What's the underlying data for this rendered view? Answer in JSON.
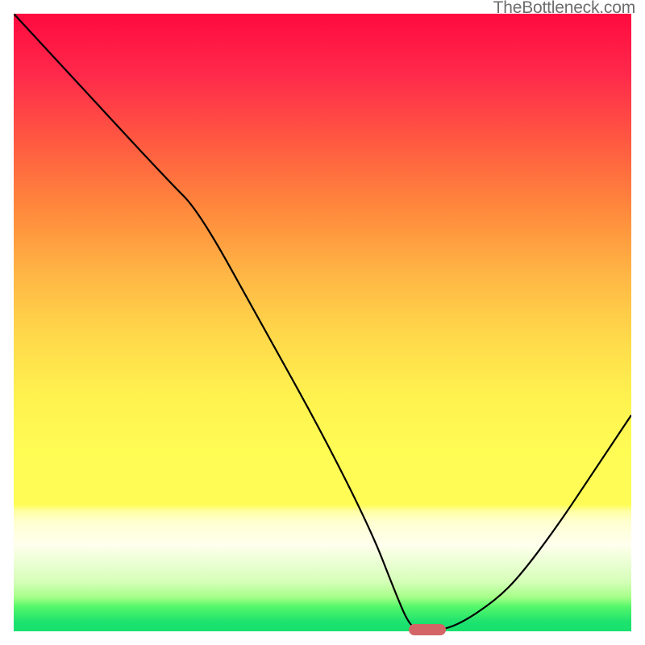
{
  "watermark": "TheBottleneck.com",
  "chart_data": {
    "type": "line",
    "title": "",
    "xlabel": "",
    "ylabel": "",
    "xlim": [
      0,
      100
    ],
    "ylim": [
      0,
      100
    ],
    "grid": false,
    "legend": false,
    "series": [
      {
        "name": "bottleneck-curve",
        "x": [
          0,
          12,
          25,
          30,
          40,
          50,
          58,
          61.5,
          64,
          66,
          68,
          72,
          78,
          82,
          88,
          94,
          100
        ],
        "y": [
          100,
          87,
          73,
          68,
          50,
          32,
          16,
          7,
          1,
          0,
          0,
          1,
          5,
          9,
          17,
          26,
          35
        ]
      }
    ],
    "optimal_marker": {
      "x_start": 64,
      "x_end": 70,
      "y": 0
    },
    "background_gradient": {
      "type": "vertical",
      "stops": [
        {
          "pos": 0.0,
          "color": "#ff0a3f"
        },
        {
          "pos": 0.22,
          "color": "#ff5f40"
        },
        {
          "pos": 0.42,
          "color": "#ffb545"
        },
        {
          "pos": 0.72,
          "color": "#fffd55"
        },
        {
          "pos": 0.82,
          "color": "#ffffcc"
        },
        {
          "pos": 0.95,
          "color": "#55f76a"
        },
        {
          "pos": 1.0,
          "color": "#18e16d"
        }
      ]
    }
  }
}
